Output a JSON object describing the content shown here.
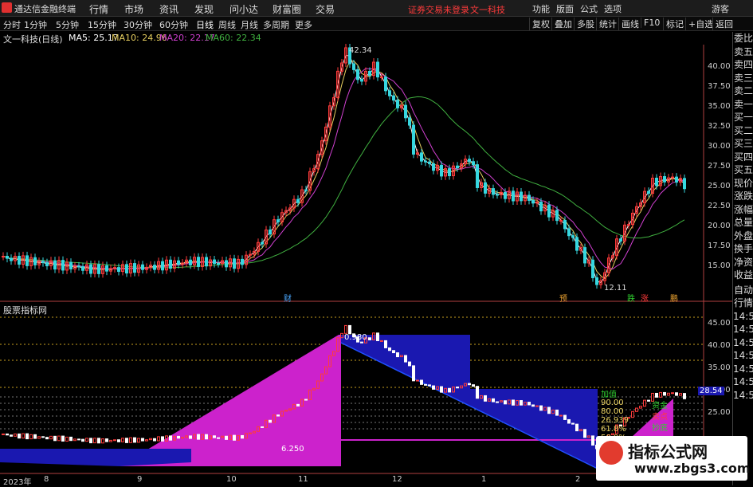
{
  "menubar": {
    "app_name": "通达信金融终端",
    "items": [
      "行情",
      "市场",
      "资讯",
      "发现",
      "问小达",
      "财富圈",
      "交易"
    ],
    "alert": "证券交易未登录",
    "stock": "文一科技",
    "right": [
      "功能",
      "版面",
      "公式",
      "选项"
    ],
    "guest": "游客"
  },
  "toolbar": {
    "periods": [
      "分时",
      "1分钟",
      "5分钟",
      "15分钟",
      "30分钟",
      "60分钟",
      "日线",
      "周线",
      "月线",
      "多周期",
      "更多"
    ],
    "active": "日线",
    "right": [
      "复权",
      "叠加",
      "多股",
      "统计",
      "画线",
      "F10",
      "标记",
      "+自选",
      "返回"
    ]
  },
  "main_legend": {
    "title": "文一科技(日线)",
    "ma5": "MA5: 25.17",
    "ma10": "MA10: 24.96",
    "ma20": "MA20: 22.17",
    "ma60": "MA60: 22.34"
  },
  "main_axis": [
    "40.00",
    "37.50",
    "35.00",
    "32.50",
    "30.00",
    "27.50",
    "25.00",
    "22.50",
    "20.00",
    "17.50",
    "15.00"
  ],
  "main_labels": {
    "high": "42.34",
    "low": "12.11",
    "markers": [
      "财",
      "预",
      "跌",
      "涨",
      "鹏"
    ]
  },
  "sub_legend": {
    "title": "股票指标网"
  },
  "sub_axis": [
    "45.00",
    "40.00",
    "35.00",
    "30.00",
    "25.00"
  ],
  "sub_labels": {
    "price_tag": "28.54",
    "low_label": "6.250",
    "top_label": "0.980",
    "right_texts": [
      "加值",
      "90.00",
      "80.00",
      "26.939",
      "61.8%",
      "50.0%",
      "资金",
      "卖点",
      "抄底"
    ]
  },
  "x_axis": [
    "2023年",
    "8",
    "9",
    "10",
    "11",
    "12",
    "1",
    "2"
  ],
  "side_panel": {
    "items": [
      "委比",
      "卖五",
      "卖四",
      "卖三",
      "卖二",
      "卖一",
      "买一",
      "买二",
      "买三",
      "买四",
      "买五",
      "现价",
      "涨跌",
      "涨幅",
      "总量",
      "外盘",
      "换手",
      "净资",
      "收益",
      "自动",
      "行情"
    ],
    "times": [
      "14:50",
      "14:50",
      "14:50",
      "14:50",
      "14:50",
      "14:50",
      "14:50"
    ]
  },
  "watermark": {
    "title": "指标公式网",
    "url": "www.zbgs3.com"
  },
  "colors": {
    "up": "#ff3b3b",
    "down": "#36d7e0",
    "ma5": "#ffffff",
    "ma10": "#e8d060",
    "ma20": "#d040d0",
    "ma60": "#40b040",
    "band_magenta": "#cc22cc",
    "band_blue": "#1a18b0"
  }
}
